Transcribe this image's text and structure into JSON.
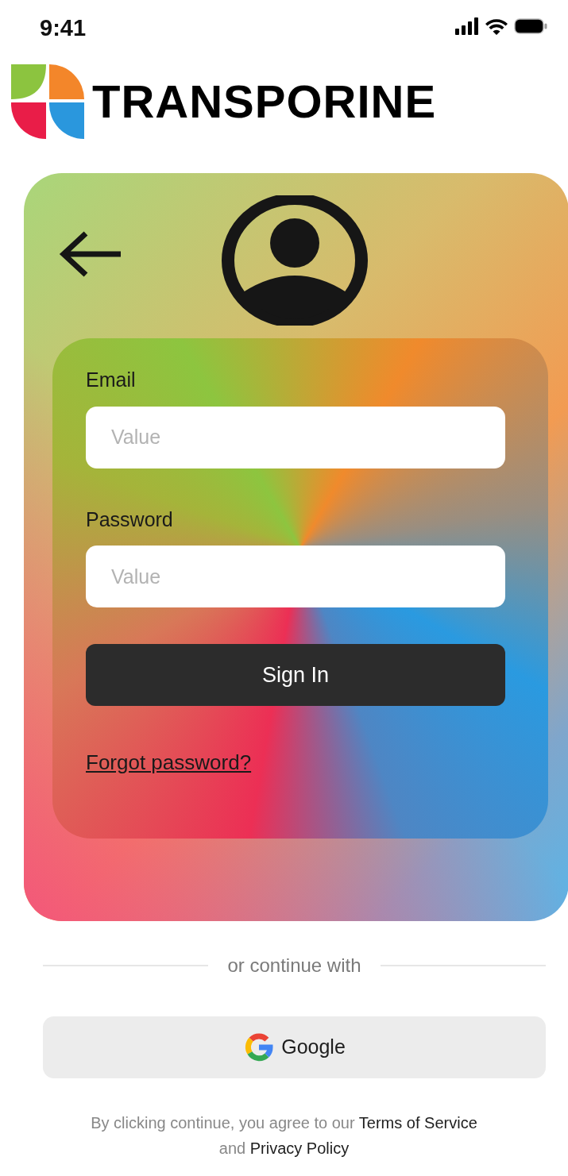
{
  "status_bar": {
    "time": "9:41"
  },
  "logo": {
    "text": "TRANSPORINE"
  },
  "form": {
    "fields": [
      {
        "label": "Email",
        "placeholder": "Value"
      },
      {
        "label": "Password",
        "placeholder": "Value"
      }
    ],
    "submit": "Sign In",
    "forgot_link": "Forgot password?"
  },
  "divider": "or continue with",
  "social_button": "Google",
  "legal": {
    "text": "By clicking continue, you agree to our",
    "terms": "Terms of Service",
    "joiner": "and",
    "privacy": "Privacy Policy"
  }
}
